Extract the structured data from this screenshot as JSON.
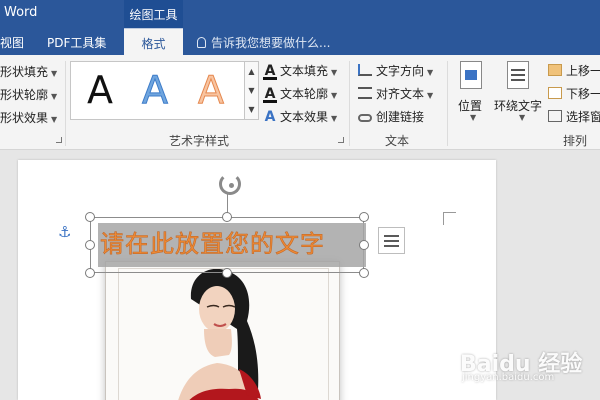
{
  "app": {
    "title": "Word",
    "context_group": "绘图工具"
  },
  "tabs": {
    "view": "视图",
    "pdf": "PDF工具集",
    "format": "格式"
  },
  "tell_me": {
    "placeholder": "告诉我您想要做什么..."
  },
  "ribbon": {
    "shape_styles": {
      "fill": "形状填充",
      "outline": "形状轮廓",
      "effects": "形状效果"
    },
    "wordart_styles": {
      "gallery": [
        "A",
        "A",
        "A"
      ],
      "text_fill": "文本填充",
      "text_outline": "文本轮廓",
      "text_effects": "文本效果",
      "label": "艺术字样式"
    },
    "text": {
      "direction": "文字方向",
      "align": "对齐文本",
      "link": "创建链接",
      "label": "文本"
    },
    "arrange": {
      "position": "位置",
      "wrap": "环绕文字",
      "bring_forward": "上移一",
      "send_backward": "下移一",
      "selection_pane": "选择窗",
      "label": "排列"
    }
  },
  "document": {
    "wordart_text": "请在此放置您的文字"
  },
  "watermark": {
    "text": "Baidu 经验",
    "url": "jingyan.baidu.com"
  },
  "colors": {
    "title_bar": "#2b579a",
    "wordart_text": "#ef8a34"
  }
}
